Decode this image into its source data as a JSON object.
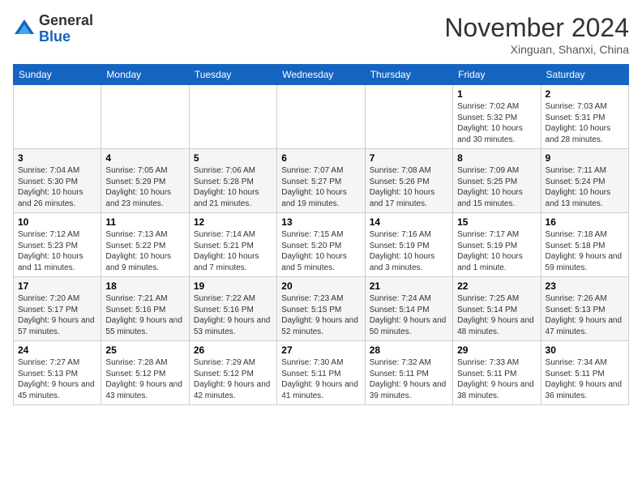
{
  "header": {
    "logo_general": "General",
    "logo_blue": "Blue",
    "month_title": "November 2024",
    "location": "Xinguan, Shanxi, China"
  },
  "weekdays": [
    "Sunday",
    "Monday",
    "Tuesday",
    "Wednesday",
    "Thursday",
    "Friday",
    "Saturday"
  ],
  "weeks": [
    [
      {
        "day": "",
        "info": ""
      },
      {
        "day": "",
        "info": ""
      },
      {
        "day": "",
        "info": ""
      },
      {
        "day": "",
        "info": ""
      },
      {
        "day": "",
        "info": ""
      },
      {
        "day": "1",
        "info": "Sunrise: 7:02 AM\nSunset: 5:32 PM\nDaylight: 10 hours and 30 minutes."
      },
      {
        "day": "2",
        "info": "Sunrise: 7:03 AM\nSunset: 5:31 PM\nDaylight: 10 hours and 28 minutes."
      }
    ],
    [
      {
        "day": "3",
        "info": "Sunrise: 7:04 AM\nSunset: 5:30 PM\nDaylight: 10 hours and 26 minutes."
      },
      {
        "day": "4",
        "info": "Sunrise: 7:05 AM\nSunset: 5:29 PM\nDaylight: 10 hours and 23 minutes."
      },
      {
        "day": "5",
        "info": "Sunrise: 7:06 AM\nSunset: 5:28 PM\nDaylight: 10 hours and 21 minutes."
      },
      {
        "day": "6",
        "info": "Sunrise: 7:07 AM\nSunset: 5:27 PM\nDaylight: 10 hours and 19 minutes."
      },
      {
        "day": "7",
        "info": "Sunrise: 7:08 AM\nSunset: 5:26 PM\nDaylight: 10 hours and 17 minutes."
      },
      {
        "day": "8",
        "info": "Sunrise: 7:09 AM\nSunset: 5:25 PM\nDaylight: 10 hours and 15 minutes."
      },
      {
        "day": "9",
        "info": "Sunrise: 7:11 AM\nSunset: 5:24 PM\nDaylight: 10 hours and 13 minutes."
      }
    ],
    [
      {
        "day": "10",
        "info": "Sunrise: 7:12 AM\nSunset: 5:23 PM\nDaylight: 10 hours and 11 minutes."
      },
      {
        "day": "11",
        "info": "Sunrise: 7:13 AM\nSunset: 5:22 PM\nDaylight: 10 hours and 9 minutes."
      },
      {
        "day": "12",
        "info": "Sunrise: 7:14 AM\nSunset: 5:21 PM\nDaylight: 10 hours and 7 minutes."
      },
      {
        "day": "13",
        "info": "Sunrise: 7:15 AM\nSunset: 5:20 PM\nDaylight: 10 hours and 5 minutes."
      },
      {
        "day": "14",
        "info": "Sunrise: 7:16 AM\nSunset: 5:19 PM\nDaylight: 10 hours and 3 minutes."
      },
      {
        "day": "15",
        "info": "Sunrise: 7:17 AM\nSunset: 5:19 PM\nDaylight: 10 hours and 1 minute."
      },
      {
        "day": "16",
        "info": "Sunrise: 7:18 AM\nSunset: 5:18 PM\nDaylight: 9 hours and 59 minutes."
      }
    ],
    [
      {
        "day": "17",
        "info": "Sunrise: 7:20 AM\nSunset: 5:17 PM\nDaylight: 9 hours and 57 minutes."
      },
      {
        "day": "18",
        "info": "Sunrise: 7:21 AM\nSunset: 5:16 PM\nDaylight: 9 hours and 55 minutes."
      },
      {
        "day": "19",
        "info": "Sunrise: 7:22 AM\nSunset: 5:16 PM\nDaylight: 9 hours and 53 minutes."
      },
      {
        "day": "20",
        "info": "Sunrise: 7:23 AM\nSunset: 5:15 PM\nDaylight: 9 hours and 52 minutes."
      },
      {
        "day": "21",
        "info": "Sunrise: 7:24 AM\nSunset: 5:14 PM\nDaylight: 9 hours and 50 minutes."
      },
      {
        "day": "22",
        "info": "Sunrise: 7:25 AM\nSunset: 5:14 PM\nDaylight: 9 hours and 48 minutes."
      },
      {
        "day": "23",
        "info": "Sunrise: 7:26 AM\nSunset: 5:13 PM\nDaylight: 9 hours and 47 minutes."
      }
    ],
    [
      {
        "day": "24",
        "info": "Sunrise: 7:27 AM\nSunset: 5:13 PM\nDaylight: 9 hours and 45 minutes."
      },
      {
        "day": "25",
        "info": "Sunrise: 7:28 AM\nSunset: 5:12 PM\nDaylight: 9 hours and 43 minutes."
      },
      {
        "day": "26",
        "info": "Sunrise: 7:29 AM\nSunset: 5:12 PM\nDaylight: 9 hours and 42 minutes."
      },
      {
        "day": "27",
        "info": "Sunrise: 7:30 AM\nSunset: 5:11 PM\nDaylight: 9 hours and 41 minutes."
      },
      {
        "day": "28",
        "info": "Sunrise: 7:32 AM\nSunset: 5:11 PM\nDaylight: 9 hours and 39 minutes."
      },
      {
        "day": "29",
        "info": "Sunrise: 7:33 AM\nSunset: 5:11 PM\nDaylight: 9 hours and 38 minutes."
      },
      {
        "day": "30",
        "info": "Sunrise: 7:34 AM\nSunset: 5:11 PM\nDaylight: 9 hours and 36 minutes."
      }
    ]
  ]
}
